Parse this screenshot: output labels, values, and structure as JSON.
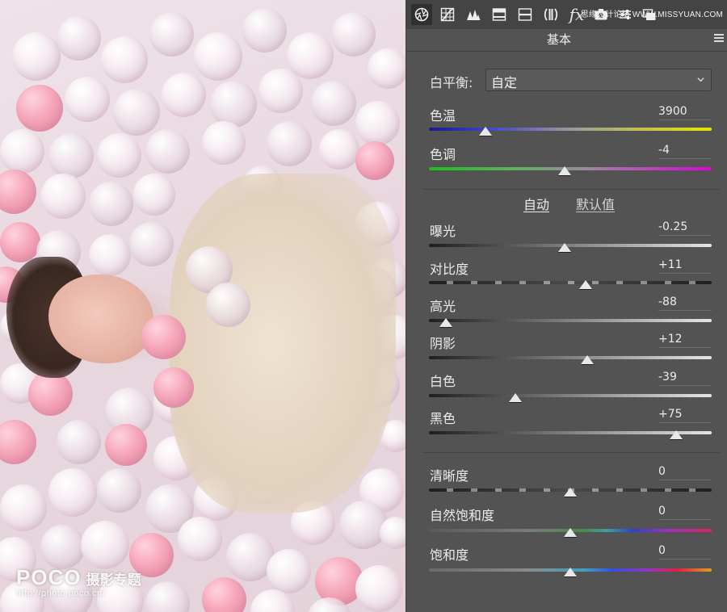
{
  "photo": {
    "watermark": {
      "logo": "POCO",
      "subtitle": "摄影专题",
      "url": "http://photo.poco.cn/"
    }
  },
  "panel": {
    "toolbar": {
      "tools": [
        {
          "icon": "aperture-icon",
          "active": true
        },
        {
          "icon": "tone-curve-icon"
        },
        {
          "icon": "detail-icon"
        },
        {
          "icon": "hsl-icon"
        },
        {
          "icon": "split-toning-icon"
        },
        {
          "icon": "lens-corrections-icon"
        },
        {
          "icon": "effects-icon"
        },
        {
          "icon": "camera-calibration-icon"
        },
        {
          "icon": "presets-icon"
        },
        {
          "icon": "snapshots-icon"
        }
      ],
      "effects_glyph": "fx",
      "site_watermark": "思缘设计论坛 WWW.MISSYUAN.COM"
    },
    "title": "基本",
    "white_balance": {
      "label": "白平衡:",
      "value": "自定"
    },
    "auto_label": "自动",
    "default_label": "默认值",
    "sliders": [
      {
        "label": "色温",
        "value": "3900",
        "level": 0.2
      },
      {
        "label": "色调",
        "value": "-4",
        "level": 0.48
      },
      {
        "label": "曝光",
        "value": "-0.25",
        "level": 0.48
      },
      {
        "label": "对比度",
        "value": "+11",
        "level": 0.555
      },
      {
        "label": "高光",
        "value": "-88",
        "level": 0.06
      },
      {
        "label": "阴影",
        "value": "+12",
        "level": 0.56
      },
      {
        "label": "白色",
        "value": "-39",
        "level": 0.305
      },
      {
        "label": "黑色",
        "value": "+75",
        "level": 0.875
      },
      {
        "label": "清晰度",
        "value": "0",
        "level": 0.5
      },
      {
        "label": "自然饱和度",
        "value": "0",
        "level": 0.5
      },
      {
        "label": "饱和度",
        "value": "0",
        "level": 0.5
      }
    ]
  }
}
